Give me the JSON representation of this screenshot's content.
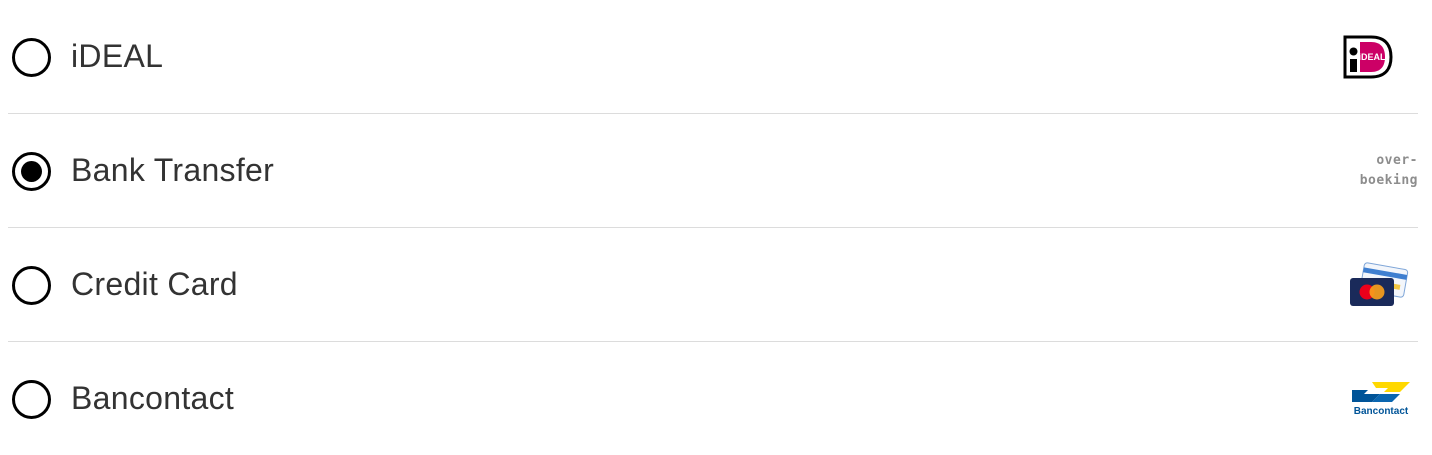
{
  "payment_methods": [
    {
      "label": "iDEAL",
      "checked": false,
      "logo_icon": "ideal-logo-icon",
      "logo_text": "iDEAL"
    },
    {
      "label": "Bank Transfer",
      "checked": true,
      "logo_icon": "overboeking-logo-icon",
      "logo_text_line1": "over-",
      "logo_text_line2": "boeking"
    },
    {
      "label": "Credit Card",
      "checked": false,
      "logo_icon": "credit-card-logo-icon"
    },
    {
      "label": "Bancontact",
      "checked": false,
      "logo_icon": "bancontact-logo-icon",
      "logo_text": "Bancontact"
    }
  ],
  "colors": {
    "ideal_pink": "#cc0066",
    "bancontact_blue": "#005498",
    "bancontact_yellow": "#ffd800",
    "mastercard_red": "#eb001b",
    "mastercard_orange": "#f79e1b",
    "card_navy": "#1a2a5a",
    "divider": "#dcdcdc",
    "label_text": "#333333"
  }
}
